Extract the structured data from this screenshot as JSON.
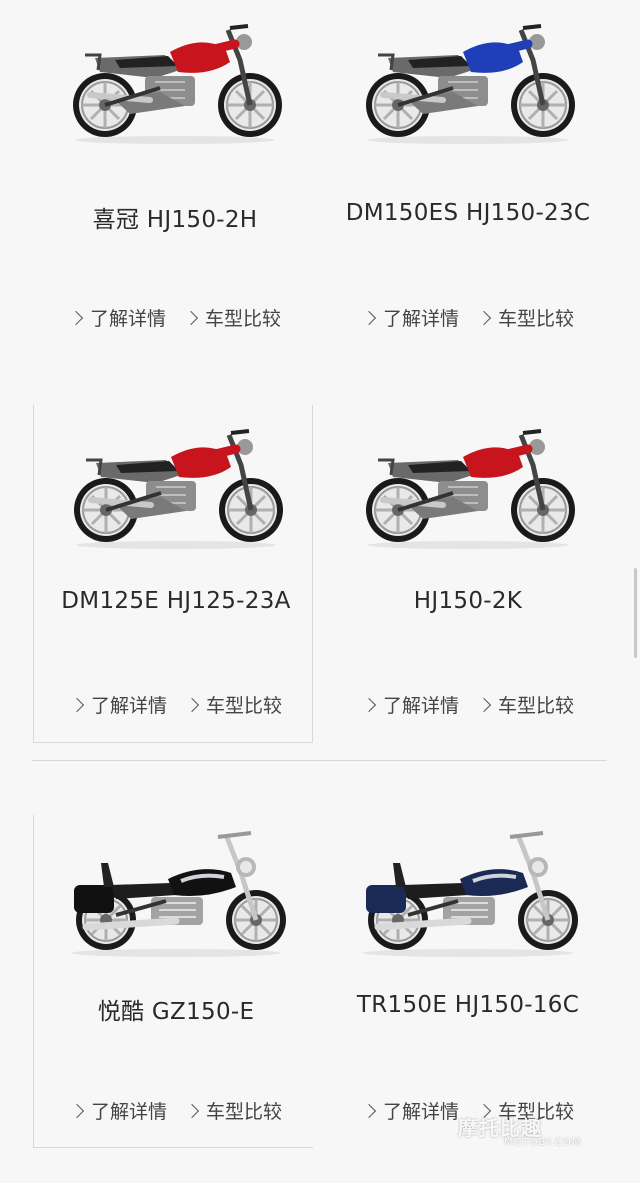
{
  "products": [
    {
      "name": "喜冠 HJ150-2H",
      "color": "#c8141c",
      "style": "standard",
      "actions": {
        "detail": "了解详情",
        "compare": "车型比较"
      }
    },
    {
      "name": "DM150ES HJ150-23C",
      "color": "#1f3fb8",
      "style": "standard",
      "actions": {
        "detail": "了解详情",
        "compare": "车型比较"
      }
    },
    {
      "name": "DM125E HJ125-23A",
      "color": "#c8141c",
      "style": "standard",
      "actions": {
        "detail": "了解详情",
        "compare": "车型比较"
      }
    },
    {
      "name": "HJ150-2K",
      "color": "#c8141c",
      "style": "standard",
      "actions": {
        "detail": "了解详情",
        "compare": "车型比较"
      }
    },
    {
      "name": "悦酷 GZ150-E",
      "color": "#111111",
      "style": "cruiser",
      "actions": {
        "detail": "了解详情",
        "compare": "车型比较"
      }
    },
    {
      "name": "TR150E HJ150-16C",
      "color": "#1b2a55",
      "style": "cruiser",
      "actions": {
        "detail": "了解详情",
        "compare": "车型比较"
      }
    }
  ],
  "watermark": {
    "logo": "摩托比趣",
    "url": "MOTOBY.COM"
  }
}
